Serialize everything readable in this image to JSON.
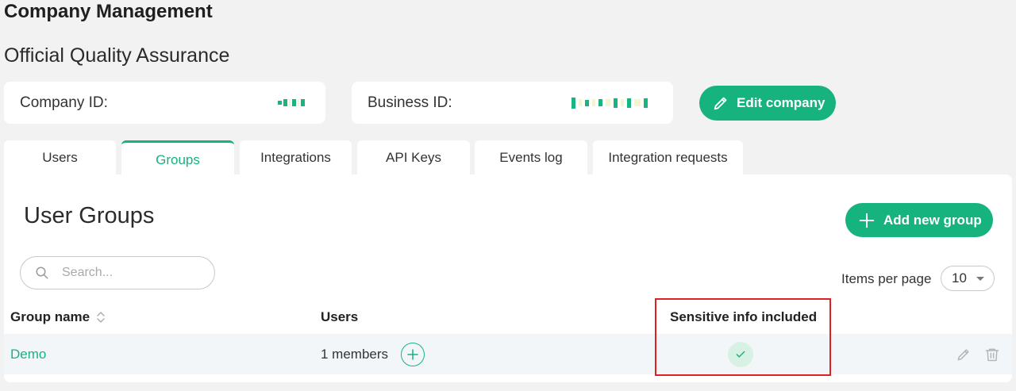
{
  "page": {
    "title": "Company Management",
    "company_name": "Official Quality Assurance"
  },
  "info": {
    "company_id_label": "Company ID:",
    "business_id_label": "Business ID:",
    "edit_company_label": "Edit company"
  },
  "tabs": [
    {
      "label": "Users",
      "active": false
    },
    {
      "label": "Groups",
      "active": true
    },
    {
      "label": "Integrations",
      "active": false
    },
    {
      "label": "API Keys",
      "active": false
    },
    {
      "label": "Events log",
      "active": false
    },
    {
      "label": "Integration requests",
      "active": false
    }
  ],
  "groups": {
    "title": "User Groups",
    "add_button_label": "Add new group",
    "search_placeholder": "Search...",
    "items_per_page_label": "Items per page",
    "items_per_page_value": "10",
    "columns": {
      "name": "Group name",
      "users": "Users",
      "sensitive": "Sensitive info included"
    },
    "rows": [
      {
        "name": "Demo",
        "users": "1 members",
        "sensitive": true
      }
    ]
  },
  "colors": {
    "accent": "#17b37e",
    "highlight": "#e02020",
    "background": "#f2f2f2"
  },
  "icons": {
    "edit_company": "pencil-icon",
    "add_group": "plus-icon",
    "search": "search-icon",
    "sort": "sort-icon",
    "add_member": "plus-circle-icon",
    "sensitive_check": "check-icon",
    "edit_row": "pencil-icon",
    "delete_row": "trash-icon"
  }
}
